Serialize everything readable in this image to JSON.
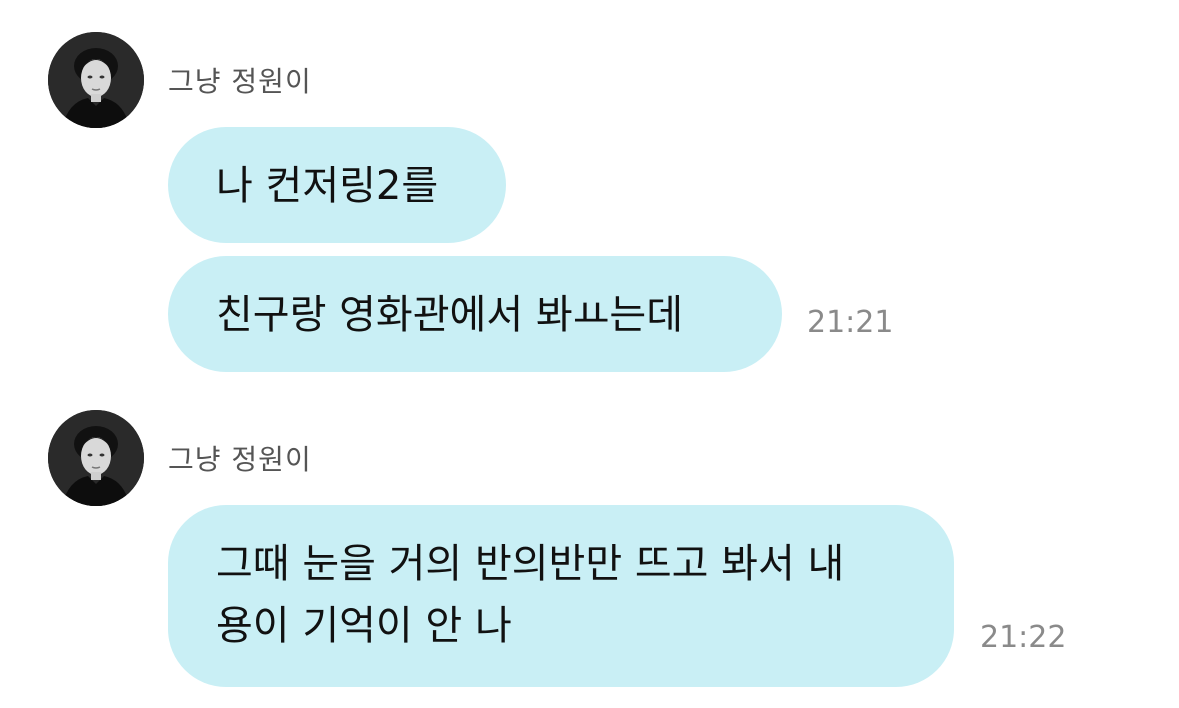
{
  "groups": [
    {
      "sender": "그냥 정원이",
      "avatar_icon": "profile-photo",
      "messages": [
        {
          "lines": [
            "나 컨저링2를"
          ]
        },
        {
          "lines": [
            "친구랑 영화관에서 봐ㅛ는데"
          ],
          "time": "21:21"
        }
      ]
    },
    {
      "sender": "그냥 정원이",
      "avatar_icon": "profile-photo",
      "messages": [
        {
          "lines": [
            "그때 눈을 거의 반의반만 뜨고 봐서 내",
            "용이 기억이 안 나"
          ],
          "time": "21:22"
        }
      ]
    }
  ],
  "colors": {
    "bubble": "#c9eff5",
    "text": "#111111",
    "sender": "#555555",
    "time": "#8a8a8a"
  }
}
